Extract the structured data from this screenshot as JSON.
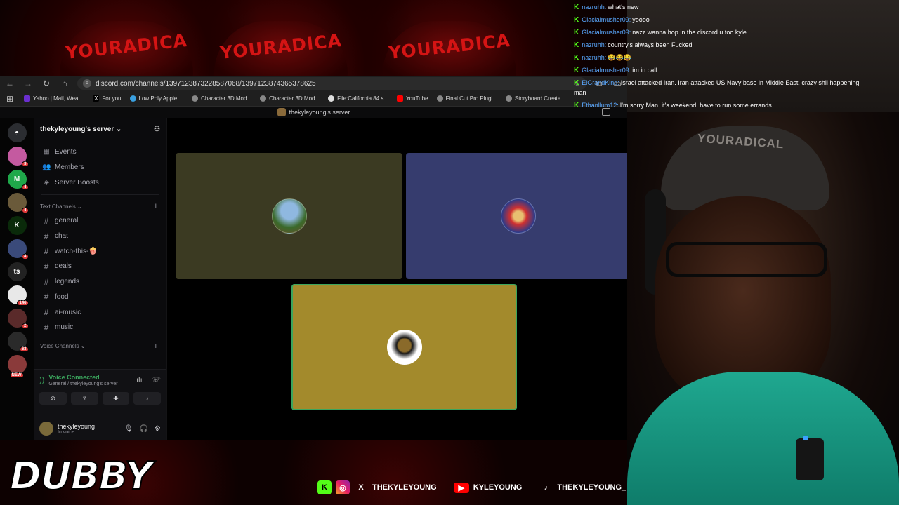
{
  "background": {
    "cap_text": "YOURADICA"
  },
  "browser": {
    "url": "discord.com/channels/1397123873228587068/1397123874365378625",
    "bookmarks": [
      "Yahoo | Mail, Weat...",
      "For you",
      "Low Poly Apple ...",
      "Character 3D Mod...",
      "Character 3D Mod...",
      "File:California 84.s...",
      "YouTube",
      "Final Cut Pro Plugi...",
      "Storyboard Create..."
    ]
  },
  "discord": {
    "title": "thekyleyoung's server",
    "server_name": "thekyleyoung's server",
    "guilds": [
      {
        "label": "",
        "badge": "3",
        "color": "#c45aa0"
      },
      {
        "label": "M",
        "badge": "4",
        "color": "#1fa84a"
      },
      {
        "label": "",
        "badge": "4",
        "color": "#6a5a3a"
      },
      {
        "label": "K",
        "badge": "",
        "color": "#0a2a0a"
      },
      {
        "label": "",
        "badge": "4",
        "color": "#3a4a7a"
      },
      {
        "label": "ts",
        "badge": "",
        "color": "#222"
      },
      {
        "label": "",
        "badge": "146",
        "color": "#e8e8e8"
      },
      {
        "label": "",
        "badge": "2",
        "color": "#5a2a2a"
      },
      {
        "label": "",
        "badge": "63",
        "color": "#2a2a2a"
      },
      {
        "label": "",
        "badge": "NEW",
        "color": "#8a3a3a"
      }
    ],
    "menu": [
      "Events",
      "Members",
      "Server Boosts"
    ],
    "text_category": "Text Channels",
    "text_channels": [
      "general",
      "chat",
      "watch-this-🍿",
      "deals",
      "legends",
      "food",
      "ai-music",
      "music"
    ],
    "voice_category": "Voice Channels",
    "voice": {
      "status": "Voice Connected",
      "location": "General / thekyleyoung's server"
    },
    "user": {
      "name": "thekyleyoung",
      "status": "In voice"
    },
    "tiles": [
      {
        "color": "#3b3a22"
      },
      {
        "color": "#363c6e"
      },
      {
        "color": "#a38a2c"
      }
    ]
  },
  "chat": {
    "messages": [
      {
        "user": "nazruhh:",
        "text": "what's new"
      },
      {
        "user": "Glacialmusher09:",
        "text": "yoooo"
      },
      {
        "user": "Glacialmusher09:",
        "text": "nazz wanna hop in the discord u too kyle"
      },
      {
        "user": "nazruhh:",
        "text": "country's always been Fucked"
      },
      {
        "user": "nazruhh:",
        "text": "😂😂😂"
      },
      {
        "user": "Glacialmusher09:",
        "text": "im in call"
      },
      {
        "user": "ElGrandKing:",
        "text": "Israel attacked Iran. Iran attacked US Navy base in Middle East. crazy shii happening"
      },
      {
        "user": "",
        "text": "man"
      },
      {
        "user": "Ethanllum12:",
        "text": "I'm sorry Man. it's weekend. have to run some errands."
      }
    ]
  },
  "webcam": {
    "hat_text": "YOURADICAL"
  },
  "brand": "DUBBY",
  "socials": {
    "kick_handle": "THEKYLEYOUNG",
    "youtube_handle": "KYLEYOUNG",
    "tiktok_handle": "THEKYLEYOUNG_"
  }
}
